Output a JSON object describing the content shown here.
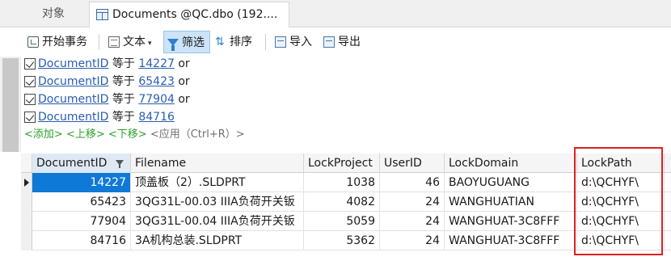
{
  "tabs": {
    "objects": "对象",
    "documents": "Documents @QC.dbo (192...."
  },
  "toolbar": {
    "begin_transaction": "开始事务",
    "text": "文本",
    "filter": "筛选",
    "sort": "排序",
    "import": "导入",
    "export": "导出"
  },
  "filter_panel": {
    "conditions": [
      {
        "field": "DocumentID",
        "operator": "等于",
        "value": "14227",
        "connector": "or"
      },
      {
        "field": "DocumentID",
        "operator": "等于",
        "value": "65423",
        "connector": "or"
      },
      {
        "field": "DocumentID",
        "operator": "等于",
        "value": "77904",
        "connector": "or"
      },
      {
        "field": "DocumentID",
        "operator": "等于",
        "value": "84716",
        "connector": ""
      }
    ],
    "actions": {
      "add": "<添加>",
      "move_up": "<上移>",
      "move_down": "<下移>",
      "apply": "<应用（Ctrl+R）>"
    }
  },
  "grid": {
    "columns": [
      "DocumentID",
      "Filename",
      "LockProject",
      "UserID",
      "LockDomain",
      "LockPath"
    ],
    "rows": [
      {
        "DocumentID": "14227",
        "Filename": "顶盖板（2）.SLDPRT",
        "LockProject": "1038",
        "UserID": "46",
        "LockDomain": "BAOYUGUANG",
        "LockPath": "d:\\QCHYF\\"
      },
      {
        "DocumentID": "65423",
        "Filename": "3QG31L-00.03 IIIA负荷开关钣",
        "LockProject": "4082",
        "UserID": "24",
        "LockDomain": "WANGHUATIAN",
        "LockPath": "d:\\QCHYF\\"
      },
      {
        "DocumentID": "77904",
        "Filename": "3QG31L-00.04 IIIA负荷开关钣",
        "LockProject": "5059",
        "UserID": "24",
        "LockDomain": "WANGHUAT-3C8FFF",
        "LockPath": "d:\\QCHYF\\"
      },
      {
        "DocumentID": "84716",
        "Filename": "3A机构总装.SLDPRT",
        "LockProject": "5362",
        "UserID": "24",
        "LockDomain": "WANGHUAT-3C8FFF",
        "LockPath": "d:\\QCHYF\\"
      }
    ]
  },
  "colors": {
    "selection": "#0f79d7",
    "link": "#2a5db0",
    "action_green": "#2ca02c",
    "highlight_box": "#e02020"
  }
}
